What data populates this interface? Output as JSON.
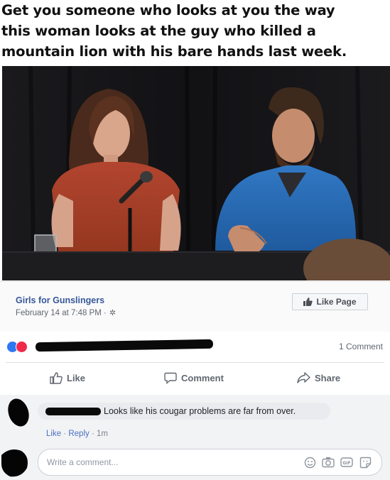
{
  "caption": {
    "line1": "Get you someone who looks at you the way",
    "line2": "this woman looks at the guy who killed a",
    "line3": "mountain lion with his bare hands last week."
  },
  "post": {
    "page_name": "Girls for Gunslingers",
    "date": "February 14 at 7:48 PM ·",
    "like_page_label": "Like Page",
    "comment_count": "1 Comment",
    "actions": {
      "like": "Like",
      "comment": "Comment",
      "share": "Share"
    }
  },
  "comment": {
    "text": "Looks like his cougar problems are far from over.",
    "like": "Like",
    "reply": "Reply",
    "time": "1m",
    "sep": "·"
  },
  "composer": {
    "placeholder": "Write a comment..."
  },
  "colors": {
    "link": "#365899",
    "like_reaction": "#2d78f2",
    "love_reaction": "#f0284a"
  },
  "icons": [
    "gear-icon",
    "thumbs-up-icon",
    "comment-icon",
    "share-icon",
    "emoji-icon",
    "camera-icon",
    "gif-icon",
    "sticker-icon"
  ]
}
